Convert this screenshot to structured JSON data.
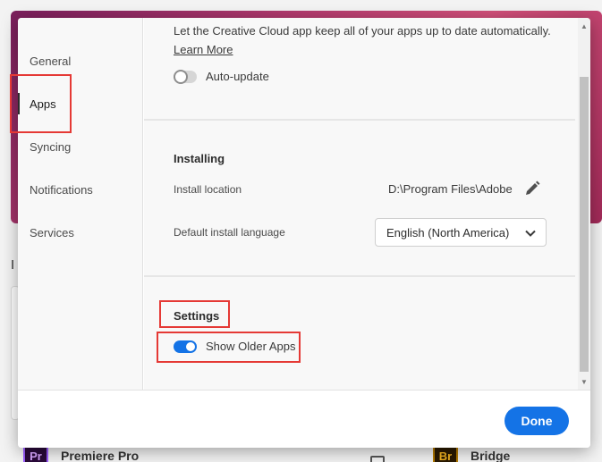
{
  "background": {
    "heading_letter": "I",
    "apps": [
      {
        "logo": "Pr",
        "name": "Premiere Pro"
      },
      {
        "logo": "Br",
        "name": "Bridge"
      }
    ]
  },
  "sidebar": {
    "items": [
      {
        "label": "General"
      },
      {
        "label": "Apps"
      },
      {
        "label": "Syncing"
      },
      {
        "label": "Notifications"
      },
      {
        "label": "Services"
      }
    ],
    "active": "Apps"
  },
  "auto_update": {
    "description": "Let the Creative Cloud app keep all of your apps up to date automatically.",
    "learn_more": "Learn More",
    "toggle_label": "Auto-update",
    "enabled": false
  },
  "installing": {
    "title": "Installing",
    "install_location_label": "Install location",
    "install_location_value": "D:\\Program Files\\Adobe",
    "language_label": "Default install language",
    "language_value": "English (North America)"
  },
  "settings": {
    "title": "Settings",
    "show_older_apps_label": "Show Older Apps",
    "show_older_apps_enabled": true
  },
  "footer": {
    "done_label": "Done"
  },
  "colors": {
    "accent": "#1473e6",
    "highlight": "#e53935"
  }
}
